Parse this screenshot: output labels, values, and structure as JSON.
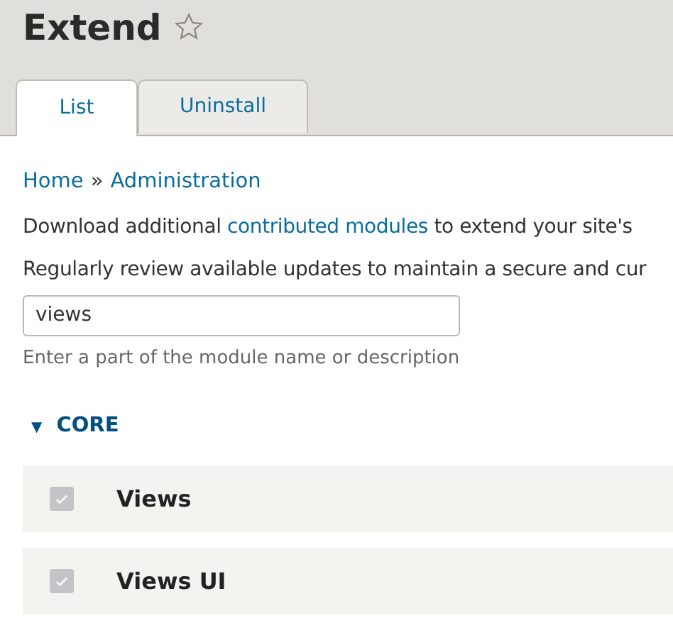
{
  "page_title": "Extend",
  "tabs": [
    {
      "label": "List",
      "selected": true
    },
    {
      "label": "Uninstall",
      "selected": false
    }
  ],
  "breadcrumb": [
    {
      "label": "Home"
    },
    {
      "label": "Administration"
    }
  ],
  "breadcrumb_separator": "»",
  "intro": [
    {
      "before": "Download additional ",
      "link": "contributed modules",
      "after": " to extend your site's"
    },
    {
      "before": "Regularly review available updates to maintain a secure and cur"
    }
  ],
  "filter": {
    "value": "views",
    "description": "Enter a part of the module name or description"
  },
  "group": {
    "label": "CORE",
    "expanded": true,
    "toggle": "▼",
    "modules": [
      {
        "name": "Views",
        "checked": true,
        "disabled": true
      },
      {
        "name": "Views UI",
        "checked": true,
        "disabled": true
      }
    ]
  }
}
